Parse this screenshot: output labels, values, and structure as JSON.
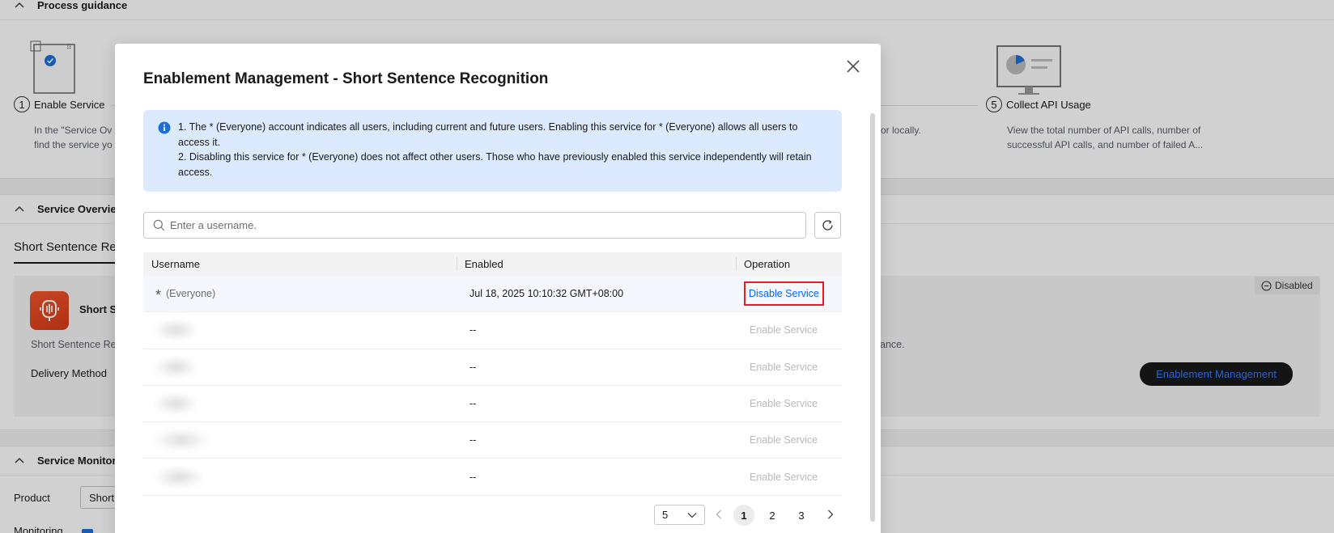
{
  "background": {
    "process_guidance": {
      "title": "Process guidance",
      "step1_label": "Enable Service",
      "step1_num": "1",
      "step1_desc_line1": "In the \"Service Ov",
      "step1_desc_line2": "find the service yo",
      "step4_partial": "or locally.",
      "step5_num": "5",
      "step5_label": "Collect API Usage",
      "step5_desc_line1": "View the total number of API calls, number of",
      "step5_desc_line2": "successful API calls, and number of failed A..."
    },
    "service_overview": {
      "title": "Service Overvie",
      "tab": "Short Sentence Rec",
      "service_name": "Short S",
      "service_desc": "Short Sentence Re",
      "service_desc_tail": "ance.",
      "delivery_label": "Delivery Method",
      "status_badge": "Disabled",
      "enablement_button": "Enablement Management"
    },
    "service_monitoring": {
      "title": "Service Monitori",
      "product_label": "Product",
      "product_value": "Short",
      "monitoring_label": "Monitoring"
    }
  },
  "modal": {
    "title": "Enablement Management - Short Sentence Recognition",
    "info_line1": "1. The * (Everyone) account indicates all users, including current and future users. Enabling this service for * (Everyone) allows all users to access it.",
    "info_line2": "2. Disabling this service for * (Everyone) does not affect other users. Those who have previously enabled this service independently will retain access.",
    "search_placeholder": "Enter a username.",
    "columns": {
      "username": "Username",
      "enabled": "Enabled",
      "operation": "Operation"
    },
    "rows": [
      {
        "star": "*",
        "username": "(Everyone)",
        "enabled": "Jul 18, 2025 10:10:32 GMT+08:00",
        "operation": "Disable Service"
      },
      {
        "enabled": "--",
        "operation": "Enable Service"
      },
      {
        "enabled": "--",
        "operation": "Enable Service"
      },
      {
        "enabled": "--",
        "operation": "Enable Service"
      },
      {
        "enabled": "--",
        "operation": "Enable Service"
      },
      {
        "enabled": "--",
        "operation": "Enable Service"
      }
    ],
    "pagination": {
      "page_size": "5",
      "pages": [
        "1",
        "2",
        "3"
      ],
      "current": "1"
    }
  },
  "colors": {
    "accent": "#0066ff",
    "highlight_border": "#e02020",
    "info_bg": "#dceaff"
  }
}
